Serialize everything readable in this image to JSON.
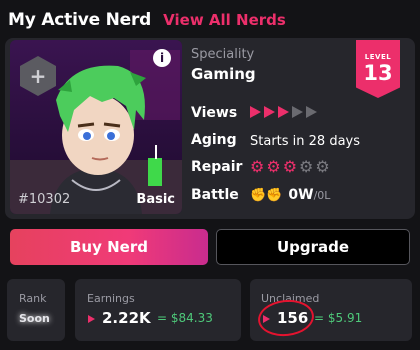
{
  "header": {
    "title": "My Active Nerd",
    "view_all": "View All Nerds"
  },
  "colors": {
    "accent": "#ec2f6b",
    "money": "#4ec97a",
    "annotation": "#e4132f"
  },
  "nerd": {
    "id": "#10302",
    "tier": "Basic",
    "specialty_label": "Speciality",
    "specialty": "Gaming",
    "level_label": "LEVEL",
    "level": "13",
    "views": {
      "label": "Views",
      "filled": 3,
      "total": 5
    },
    "aging": {
      "label": "Aging",
      "value": "Starts in 28 days"
    },
    "repair": {
      "label": "Repair",
      "filled": 3,
      "total": 5
    },
    "battle": {
      "label": "Battle",
      "wins": "0W",
      "losses": "/0L"
    }
  },
  "actions": {
    "buy": "Buy Nerd",
    "upgrade": "Upgrade"
  },
  "stats": {
    "rank": {
      "label": "Rank",
      "value": "Soon"
    },
    "earnings": {
      "label": "Earnings",
      "value": "2.22K",
      "usd": "= $84.33"
    },
    "unclaimed": {
      "label": "Unclaimed",
      "value": "156",
      "usd": "= $5.91"
    }
  },
  "icons": [
    "plus-icon",
    "info-icon",
    "view-triangle-icon",
    "gear-icon",
    "boxing-gloves-icon",
    "play-icon"
  ]
}
